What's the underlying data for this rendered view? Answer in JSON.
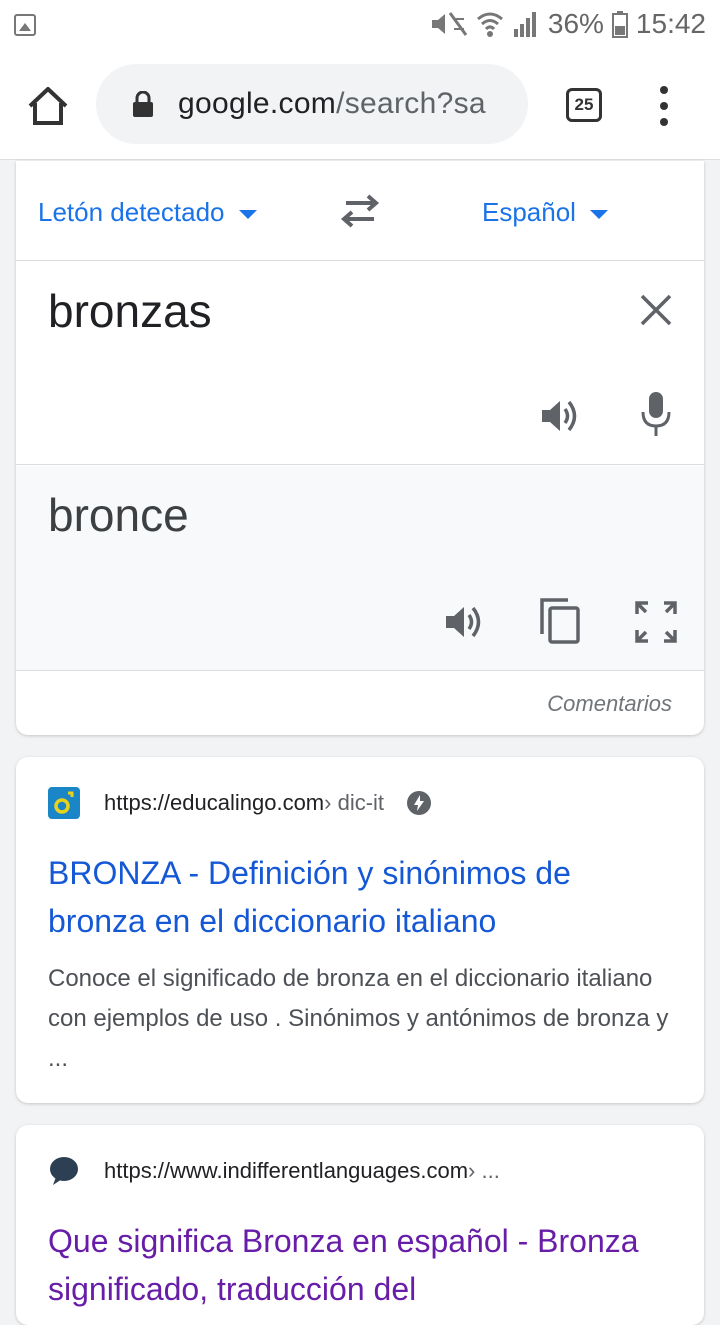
{
  "status_bar": {
    "battery": "36%",
    "time": "15:42"
  },
  "browser": {
    "url_domain": "google.com",
    "url_path": "/search?sa",
    "tab_count": "25"
  },
  "translate": {
    "source_lang": "Letón detectado",
    "target_lang": "Español",
    "source_text": "bronzas",
    "target_text": "bronce",
    "feedback": "Comentarios"
  },
  "results": [
    {
      "site": "https://educalingo.com",
      "path": " › dic-it",
      "title": "BRONZA - Definición y sinónimos de bronza en el diccionario italiano",
      "snippet": "Conoce el significado de bronza en el diccionario italiano con ejemplos de uso . Sinónimos y antónimos de bronza y ..."
    },
    {
      "site": "https://www.indifferentlanguages.com",
      "path": " › ...",
      "title": "Que significa Bronza en español - Bronza significado, traducción del"
    }
  ],
  "colors": {
    "link_blue": "#1558d6",
    "link_visited": "#681da8",
    "accent": "#1a73e8"
  }
}
